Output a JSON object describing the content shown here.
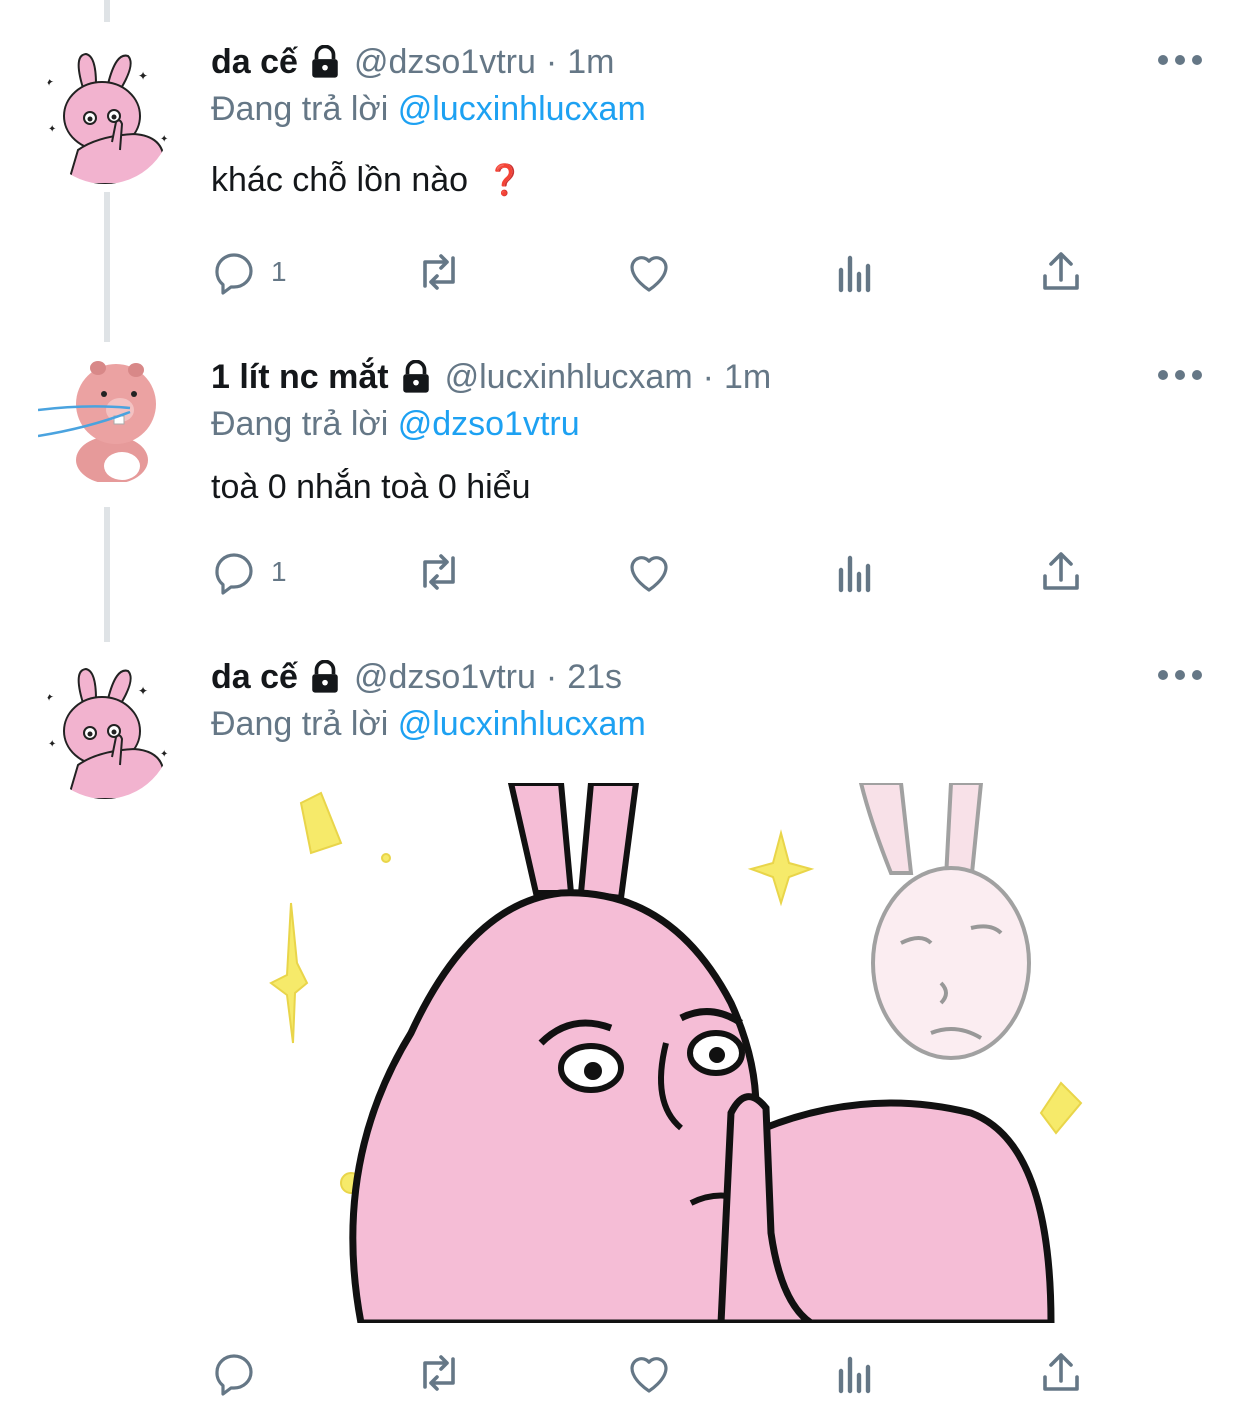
{
  "tweets": [
    {
      "display_name": "da cế",
      "handle": "@dzso1vtru",
      "separator": "·",
      "time": "1m",
      "replying_prefix": "Đang trả lời",
      "replying_to": "@lucxinhlucxam",
      "text": "khác chỗ lồn nào",
      "emoji": "❓",
      "reply_count": "1",
      "avatar": "pink-rabbit-avatar"
    },
    {
      "display_name": "1 lít nc mắt",
      "handle": "@lucxinhlucxam",
      "separator": "·",
      "time": "1m",
      "replying_prefix": "Đang trả lời",
      "replying_to": "@dzso1vtru",
      "text": "toà 0 nhắn toà 0 hiểu",
      "reply_count": "1",
      "avatar": "pink-beaver-avatar"
    },
    {
      "display_name": "da cế",
      "handle": "@dzso1vtru",
      "separator": "·",
      "time": "21s",
      "replying_prefix": "Đang trả lời",
      "replying_to": "@lucxinhlucxam",
      "media": "pink-rabbit-meme-image",
      "avatar": "pink-rabbit-avatar"
    }
  ],
  "icons": {
    "reply": "reply-icon",
    "retweet": "retweet-icon",
    "like": "heart-icon",
    "analytics": "analytics-icon",
    "share": "share-icon",
    "more": "more-icon",
    "lock": "lock-icon"
  },
  "colors": {
    "text": "#14171a",
    "secondary": "#657786",
    "link": "#1da1f2",
    "thread_line": "#dfe3e6",
    "avatar_pink": "#f2b3cf"
  }
}
